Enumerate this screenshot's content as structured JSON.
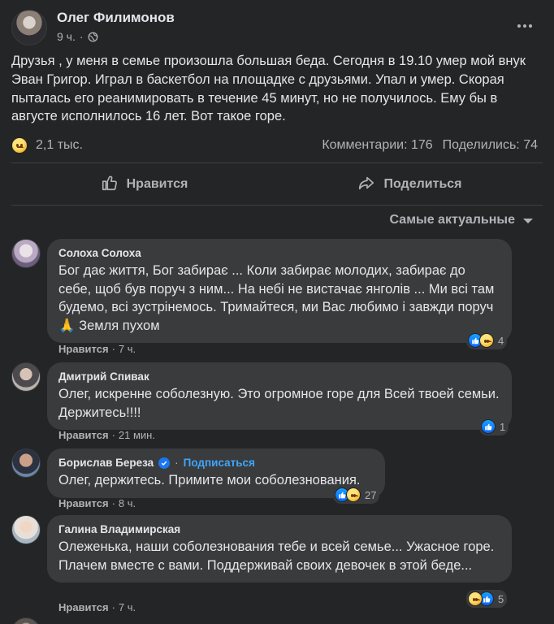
{
  "post": {
    "author": "Олег Филимонов",
    "time": "9 ч.",
    "text": "Друзья , у меня в семье произошла большая беда. Сегодня в 19.10 умер мой внук Эван Григор. Играл в баскетбол на площадке с друзьями. Упал и умер. Скорая пыталась его реанимировать в течение 45 минут, но не получилось. Ему бы в августе исполнилось 16 лет. Вот такое горе.",
    "reaction_count": "2,1 тыс.",
    "comments_label": "Комментарии: 176",
    "shares_label": "Поделились: 74"
  },
  "actions": {
    "like_label": "Нравится",
    "share_label": "Поделиться"
  },
  "sort": {
    "label": "Самые актуальные"
  },
  "comments": [
    {
      "name": "Солоха Солоха",
      "text": "Бог дає життя, Бог забирає ... Коли забирає молодих, забирає до себе, щоб був поруч з ним... На небі не вистачає янголів ... Ми всі там будемо, всі зустрінемось. Тримайтеся, ми Вас любимо і завжди поруч 🙏 Земля пухом",
      "like_label": "Нравится",
      "time": "7 ч.",
      "reaction_count": "4"
    },
    {
      "name": "Дмитрий Спивак",
      "text": "Олег, искренне соболезную. Это огромное горе для Всей твоей семьи. Держитесь!!!!",
      "like_label": "Нравится",
      "time": "21 мин.",
      "reaction_count": "1"
    },
    {
      "name": "Борислав Береза",
      "subscribe_label": "Подписаться",
      "text": "Олег, держитесь. Примите мои соболезнования.",
      "like_label": "Нравится",
      "time": "8 ч.",
      "reaction_count": "27"
    },
    {
      "name": "Галина Владимирская",
      "text": "Олеженька, наши соболезнования тебе и всей семье... Ужасное горе. Плачем вместе с вами. Поддерживай своих девочек в этой беде...",
      "like_label": "Нравится",
      "time": "7 ч.",
      "reaction_count": "5"
    }
  ],
  "colors": {
    "background": "#242526",
    "bubble": "#3a3b3c",
    "text": "#e4e6eb",
    "secondary_text": "#b0b3b8",
    "link_blue": "#3ea6ff",
    "like_blue": "#1877f2"
  },
  "icons": [
    "globe-icon",
    "more-icon",
    "sad-reaction-icon",
    "like-reaction-icon",
    "thumbs-up-icon",
    "share-icon",
    "caret-down-icon",
    "verified-icon"
  ]
}
